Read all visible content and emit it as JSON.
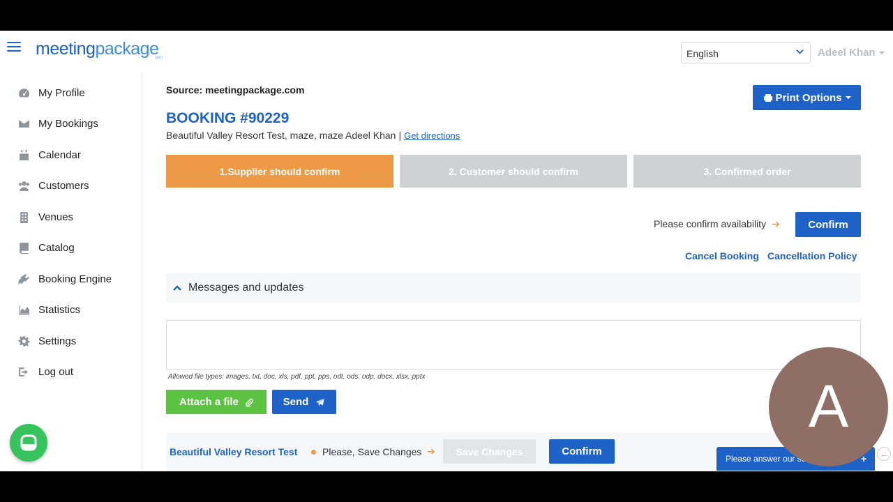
{
  "header": {
    "logo_main": "meeting",
    "logo_accent": "package",
    "logo_suffix": ".com",
    "language": "English",
    "user_name": "Adeel Khan"
  },
  "sidebar": {
    "items": [
      {
        "label": "My Profile",
        "icon": "dashboard-icon"
      },
      {
        "label": "My Bookings",
        "icon": "envelope-icon"
      },
      {
        "label": "Calendar",
        "icon": "calendar-icon"
      },
      {
        "label": "Customers",
        "icon": "users-icon"
      },
      {
        "label": "Venues",
        "icon": "building-icon"
      },
      {
        "label": "Catalog",
        "icon": "book-icon"
      },
      {
        "label": "Booking Engine",
        "icon": "plug-icon"
      },
      {
        "label": "Statistics",
        "icon": "area-chart-icon"
      },
      {
        "label": "Settings",
        "icon": "gear-icon"
      },
      {
        "label": "Log out",
        "icon": "sign-out-icon"
      }
    ]
  },
  "booking": {
    "source": "Source: meetingpackage.com",
    "print_options": "Print Options",
    "title": "BOOKING #90229",
    "subtitle": "Beautiful Valley Resort Test, maze, maze Adeel Khan",
    "separator": "|",
    "directions_link": "Get directions",
    "steps": [
      {
        "label": "1.Supplier should confirm",
        "status": "active"
      },
      {
        "label": "2. Customer should confirm",
        "status": "pending"
      },
      {
        "label": "3. Confirmed order",
        "status": "pending"
      }
    ],
    "availability_text": "Please confirm availability",
    "confirm_label": "Confirm",
    "cancel_booking": "Cancel Booking",
    "cancellation_policy": "Cancellation Policy"
  },
  "messages": {
    "section_title": "Messages and updates",
    "file_types": "Allowed file types: images, txt, doc, xls, pdf, ppt, pps, odt, ods, odp, docx, xlsx, pptx",
    "attach_label": "Attach a file",
    "send_label": "Send"
  },
  "footer": {
    "venue": "Beautiful Valley Resort Test",
    "save_prompt": "Please, Save Changes",
    "save_changes": "Save Changes",
    "confirm_label": "Confirm"
  },
  "survey": {
    "label": "Please answer our survey",
    "plus": "+",
    "more": "..."
  },
  "avatar": {
    "initial": "A"
  },
  "colors": {
    "brand_blue": "#1e62c7",
    "step_active": "#ec9a45",
    "step_inactive": "#cfd1d3",
    "attach_green": "#5cc342",
    "chat_green": "#38c25d",
    "avatar_bg": "#8f6e65"
  }
}
